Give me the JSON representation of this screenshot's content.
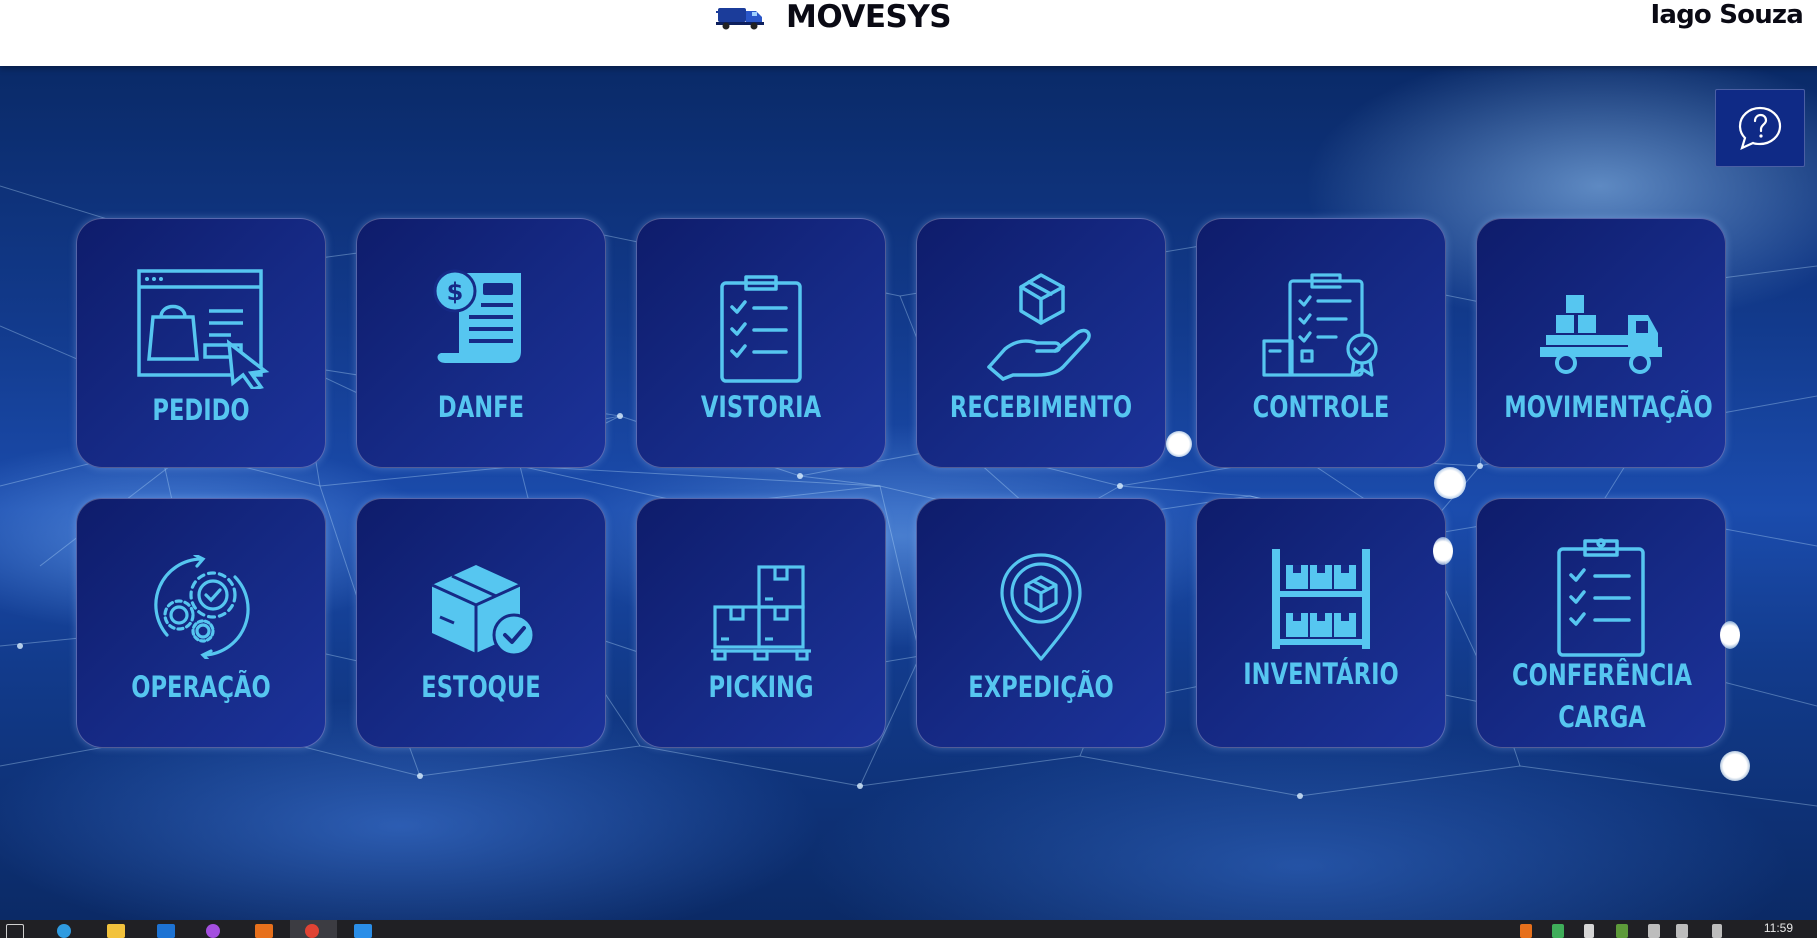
{
  "header": {
    "app_name": "MOVESYS",
    "user_name": "Iago Souza",
    "logo_icon": "truck-icon"
  },
  "help": {
    "icon": "help-chat-icon"
  },
  "colors": {
    "tile_label": "#56c6f0",
    "tile_bg": "#14257c",
    "header_bg": "#ffffff",
    "help_bg": "#0f2a86"
  },
  "modules": [
    {
      "label": "PEDIDO",
      "icon": "online-order-icon"
    },
    {
      "label": "DANFE",
      "icon": "invoice-receipt-icon"
    },
    {
      "label": "VISTORIA",
      "icon": "checklist-clipboard-icon"
    },
    {
      "label": "RECEBIMENTO",
      "icon": "hand-receiving-box-icon"
    },
    {
      "label": "CONTROLE",
      "icon": "quality-control-clipboard-icon"
    },
    {
      "label": "MOVIMENTAÇÃO",
      "icon": "delivery-truck-icon"
    },
    {
      "label": "OPERAÇÃO",
      "icon": "gears-cycle-icon"
    },
    {
      "label": "ESTOQUE",
      "icon": "box-check-icon"
    },
    {
      "label": "PICKING",
      "icon": "boxes-pallet-icon"
    },
    {
      "label": "EXPEDIÇÃO",
      "icon": "location-pin-box-icon"
    },
    {
      "label": "INVENTÁRIO",
      "icon": "warehouse-shelf-icon"
    },
    {
      "label": "CONFERÊNCIA CARGA",
      "icon": "clipboard-checklist-icon"
    }
  ],
  "taskbar": {
    "clock": "11:59"
  }
}
